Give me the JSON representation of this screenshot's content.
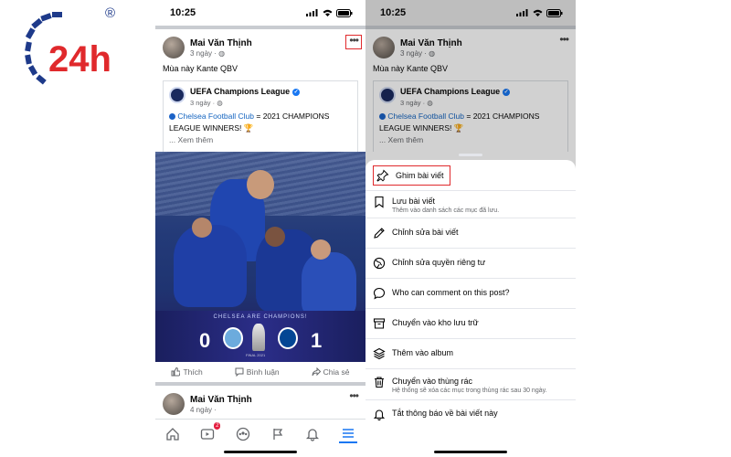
{
  "brand": {
    "logo_text": "24h",
    "registered": "®",
    "accent": "#e0292c",
    "logo_blue": "#1e3a8a"
  },
  "status": {
    "time": "10:25"
  },
  "post": {
    "author": "Mai Văn Thịnh",
    "meta": "3 ngày · ",
    "text": "Mùa này Kante QBV",
    "shared": {
      "page": "UEFA Champions League",
      "meta": "3 ngày · ",
      "link_text": "Chelsea Football Club",
      "body": " = 2021 CHAMPIONS LEAGUE WINNERS! 🏆",
      "see_more": "... Xem thêm"
    },
    "photo": {
      "banner": "CHELSEA ARE CHAMPIONS!",
      "score_left": "0",
      "score_right": "1",
      "trophy_caption": "FINAL 2021"
    },
    "actions": {
      "like": "Thích",
      "comment": "Bình luận",
      "share": "Chia sẻ"
    }
  },
  "next_post": {
    "author": "Mai Văn Thịnh",
    "meta": "4 ngày ·"
  },
  "tabbar": {
    "notification_badge": "2"
  },
  "menu": {
    "items": [
      {
        "label": "Ghim bài viết",
        "icon": "pin-icon"
      },
      {
        "label": "Lưu bài viết",
        "sub": "Thêm vào danh sách các mục đã lưu.",
        "icon": "bookmark-icon"
      },
      {
        "label": "Chỉnh sửa bài viết",
        "icon": "pencil-icon"
      },
      {
        "label": "Chỉnh sửa quyền riêng tư",
        "icon": "globe-icon"
      },
      {
        "label": "Who can comment on this post?",
        "icon": "comment-icon"
      },
      {
        "label": "Chuyển vào kho lưu trữ",
        "icon": "archive-icon"
      },
      {
        "label": "Thêm vào album",
        "icon": "album-icon"
      },
      {
        "label": "Chuyển vào thùng rác",
        "sub": "Hệ thống sẽ xóa các mục trong thùng rác sau 30 ngày.",
        "icon": "trash-icon"
      },
      {
        "label": "Tắt thông báo về bài viết này",
        "icon": "bell-icon"
      }
    ]
  }
}
